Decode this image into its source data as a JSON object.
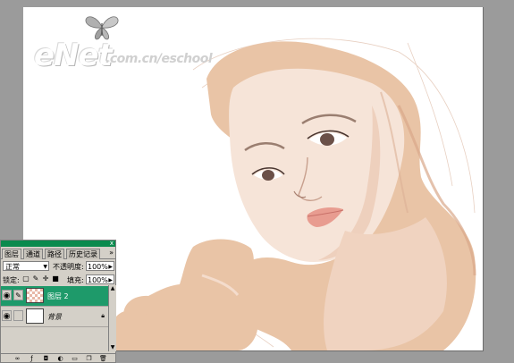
{
  "watermark": {
    "logo": "eNet",
    "url": ".com.cn/eschool"
  },
  "colors": {
    "workspace": "#9b9b9b",
    "canvas": "#ffffff",
    "skin": "#e9c4a6",
    "panel_title": "#0a8a4e",
    "layer_selected": "#1e9a6a"
  },
  "layers_panel": {
    "close_label": "x",
    "tabs": [
      {
        "label": "图层",
        "active": true
      },
      {
        "label": "通道",
        "active": false
      },
      {
        "label": "路径",
        "active": false
      },
      {
        "label": "历史记录",
        "active": false
      }
    ],
    "more_label": "»",
    "blend_mode": "正常",
    "opacity_label": "不透明度:",
    "opacity_value": "100%",
    "lock_label": "锁定:",
    "fill_label": "填充:",
    "fill_value": "100%",
    "layers": [
      {
        "name": "图层 2",
        "visible": true,
        "selected": true,
        "thumbnail": "checker"
      },
      {
        "name": "背景",
        "visible": true,
        "selected": false,
        "thumbnail": "white",
        "locked": true
      }
    ]
  }
}
